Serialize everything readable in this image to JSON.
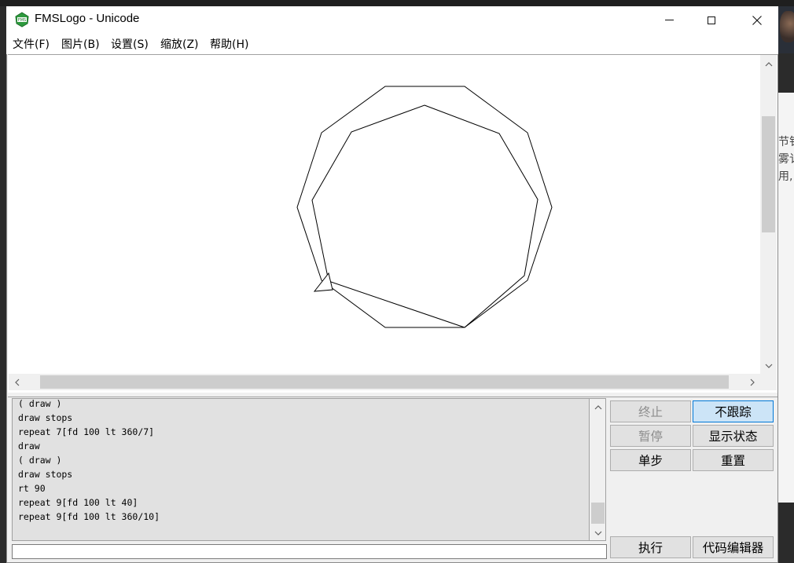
{
  "window": {
    "title": "FMSLogo - Unicode",
    "minimize_glyph": "—",
    "maximize_glyph": "☐",
    "close_glyph": "✕"
  },
  "menu": {
    "items": [
      "文件(F)",
      "图片(B)",
      "设置(S)",
      "缩放(Z)",
      "帮助(H)"
    ]
  },
  "canvas": {
    "turtle_icon": "triangle-turtle-icon"
  },
  "history": {
    "lines": [
      "( draw )",
      "draw stops",
      "repeat 7[fd 100 lt 360/7]",
      "draw",
      "( draw )",
      "draw stops",
      "rt 90",
      "repeat 9[fd 100 lt 40]",
      "repeat 9[fd 100 lt 360/10]"
    ]
  },
  "command_input": {
    "value": ""
  },
  "buttons": {
    "halt": "终止",
    "no_trace": "不跟踪",
    "pause": "暂停",
    "status": "显示状态",
    "step": "单步",
    "reset": "重置",
    "execute": "执行",
    "editor": "代码编辑器"
  },
  "side_text": [
    "节钅",
    "雾讠",
    "用,"
  ]
}
